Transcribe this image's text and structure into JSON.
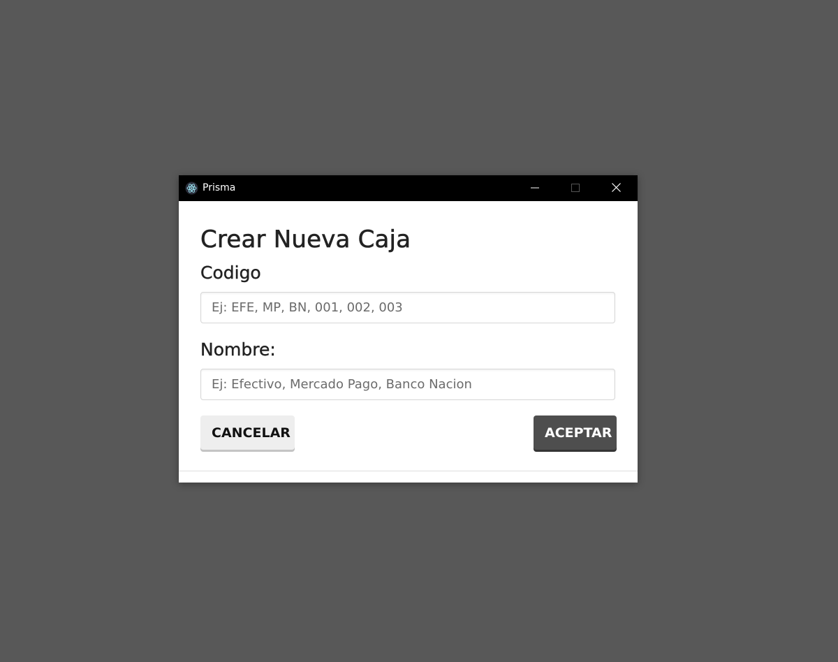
{
  "window": {
    "title": "Prisma",
    "icon": "electron-atom-icon",
    "controls": {
      "minimize": "minimize-icon",
      "maximize": "maximize-icon",
      "close": "close-icon"
    }
  },
  "form": {
    "heading": "Crear Nueva Caja",
    "codigo_label": "Codigo",
    "codigo_value": "",
    "codigo_placeholder": "Ej: EFE, MP, BN, 001, 002, 003",
    "nombre_label": "Nombre:",
    "nombre_value": "",
    "nombre_placeholder": "Ej: Efectivo, Mercado Pago, Banco Nacion"
  },
  "actions": {
    "cancel_label": "CANCELAR",
    "accept_label": "ACEPTAR"
  },
  "colors": {
    "backdrop": "#585858",
    "titlebar": "#000000",
    "accept_button": "#4e4e4e",
    "cancel_button": "#eeeeee"
  }
}
